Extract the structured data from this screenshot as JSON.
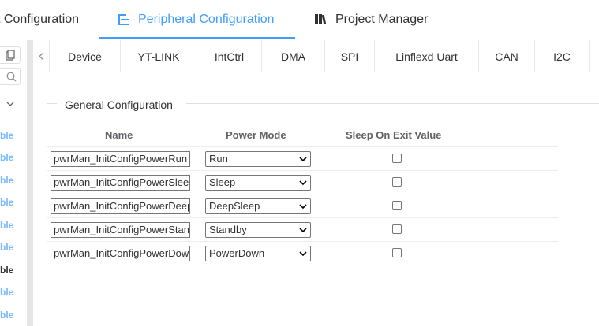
{
  "topnav": {
    "tabs": [
      {
        "label": "t Configuration",
        "active": false
      },
      {
        "label": "Peripheral Configuration",
        "active": true
      },
      {
        "label": "Project Manager",
        "active": false
      }
    ]
  },
  "sidebar": {
    "items": [
      "ble",
      "ble",
      "ble",
      "ble",
      "ble",
      "ble",
      "ble",
      "ble",
      "ble"
    ]
  },
  "tabs": [
    "Device",
    "YT-LINK",
    "IntCtrl",
    "DMA",
    "SPI",
    "Linflexd Uart",
    "CAN",
    "I2C"
  ],
  "section": {
    "legend": "General Configuration"
  },
  "table": {
    "headers": [
      "Name",
      "Power Mode",
      "Sleep On Exit Value"
    ],
    "rows": [
      {
        "name": "pwrMan_InitConfigPowerRun",
        "mode": "Run"
      },
      {
        "name": "pwrMan_InitConfigPowerSleep",
        "mode": "Sleep"
      },
      {
        "name": "pwrMan_InitConfigPowerDeepSleep",
        "mode": "DeepSleep"
      },
      {
        "name": "pwrMan_InitConfigPowerStandby",
        "mode": "Standby"
      },
      {
        "name": "pwrMan_InitConfigPowerDown",
        "mode": "PowerDown"
      }
    ]
  },
  "colors": {
    "accent": "#409eff",
    "sidebar_link": "#79bbff"
  }
}
